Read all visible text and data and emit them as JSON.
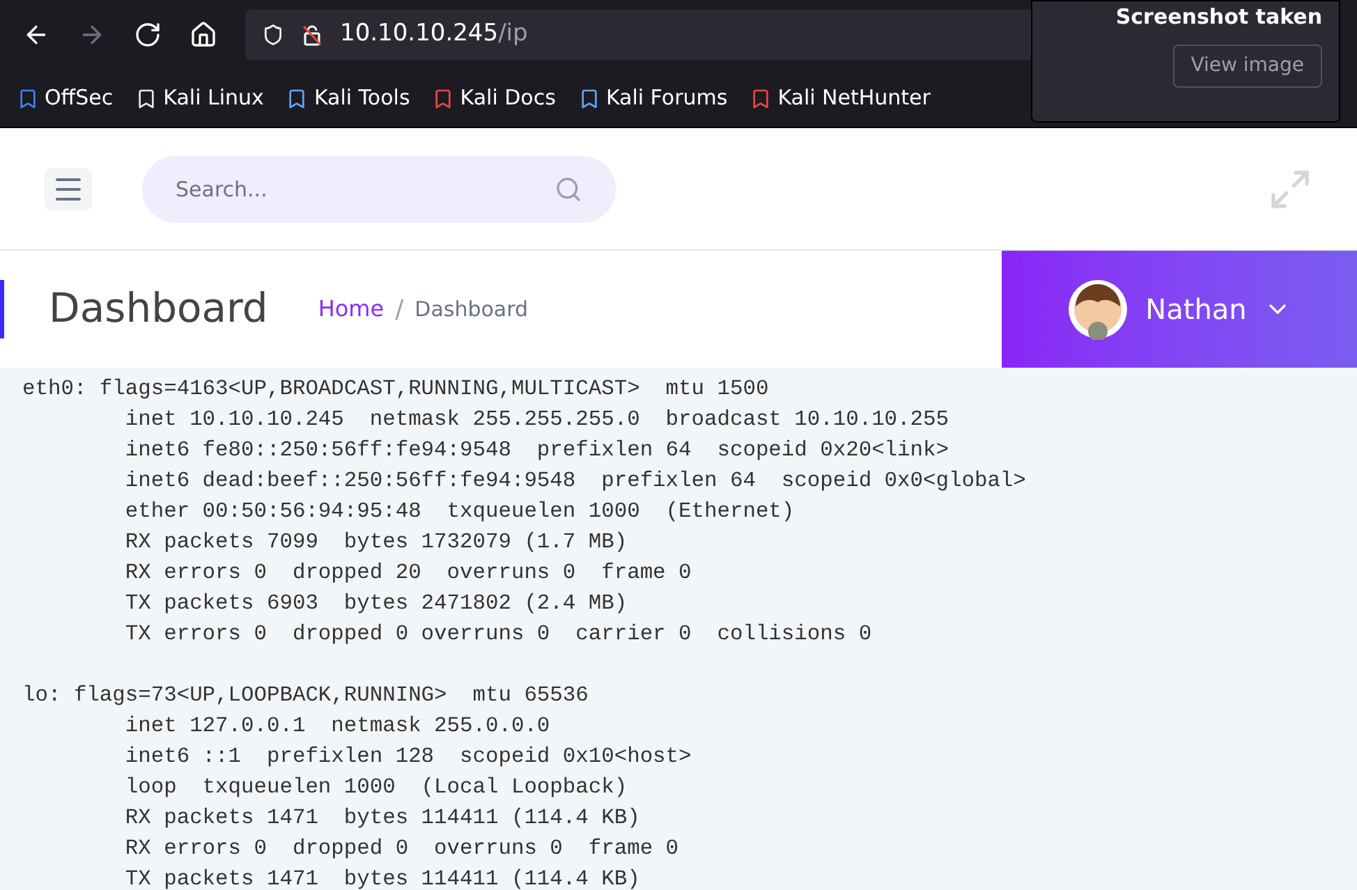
{
  "browser": {
    "url_host": "10.10.10.245",
    "url_path": "/ip",
    "bookmarks": [
      "OffSec",
      "Kali Linux",
      "Kali Tools",
      "Kali Docs",
      "Kali Forums",
      "Kali NetHunter"
    ],
    "notification": {
      "title": "Screenshot taken",
      "button": "View image"
    }
  },
  "topbar": {
    "search": {
      "placeholder": "Search..."
    }
  },
  "header": {
    "title": "Dashboard",
    "breadcrumb": [
      "Home",
      "Dashboard"
    ],
    "breadcrumb_separator": "/",
    "user": "Nathan"
  },
  "output_blocks": [
    [
      "eth0: flags=4163<UP,BROADCAST,RUNNING,MULTICAST>  mtu 1500",
      "        inet 10.10.10.245  netmask 255.255.255.0  broadcast 10.10.10.255",
      "        inet6 fe80::250:56ff:fe94:9548  prefixlen 64  scopeid 0x20<link>",
      "        inet6 dead:beef::250:56ff:fe94:9548  prefixlen 64  scopeid 0x0<global>",
      "        ether 00:50:56:94:95:48  txqueuelen 1000  (Ethernet)",
      "        RX packets 7099  bytes 1732079 (1.7 MB)",
      "        RX errors 0  dropped 20  overruns 0  frame 0",
      "        TX packets 6903  bytes 2471802 (2.4 MB)",
      "        TX errors 0  dropped 0 overruns 0  carrier 0  collisions 0"
    ],
    [
      "lo: flags=73<UP,LOOPBACK,RUNNING>  mtu 65536",
      "        inet 127.0.0.1  netmask 255.0.0.0",
      "        inet6 ::1  prefixlen 128  scopeid 0x10<host>",
      "        loop  txqueuelen 1000  (Local Loopback)",
      "        RX packets 1471  bytes 114411 (114.4 KB)",
      "        RX errors 0  dropped 0  overruns 0  frame 0",
      "        TX packets 1471  bytes 114411 (114.4 KB)"
    ]
  ]
}
